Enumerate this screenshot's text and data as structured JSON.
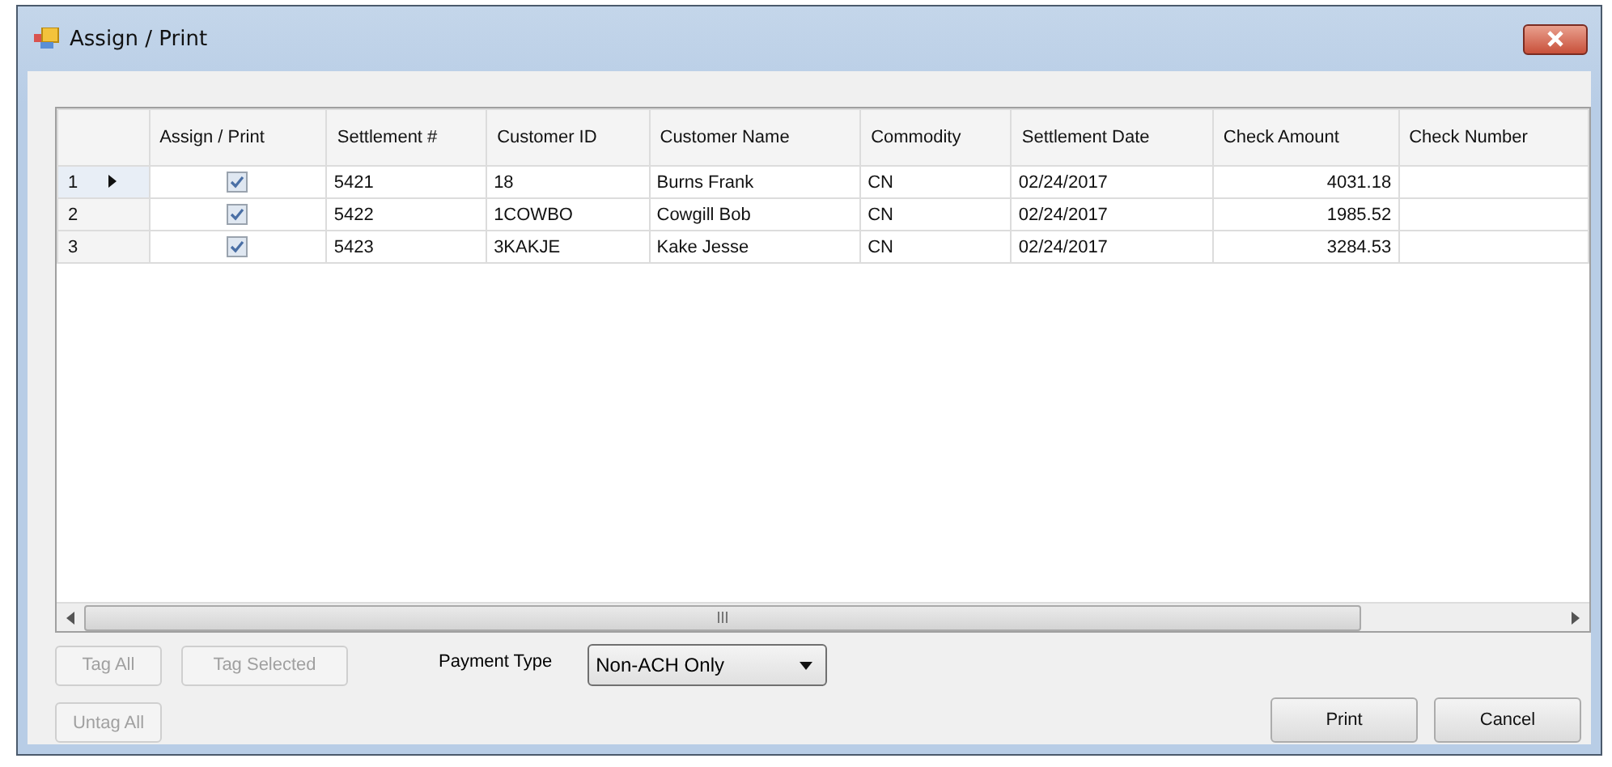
{
  "window": {
    "title": "Assign / Print"
  },
  "table": {
    "columns": [
      "",
      "Assign / Print",
      "Settlement #",
      "Customer ID",
      "Customer Name",
      "Commodity",
      "Settlement Date",
      "Check Amount",
      "Check Number"
    ],
    "rows": [
      {
        "selected": true,
        "checked": true,
        "cells": [
          "1",
          "",
          "5421",
          "18",
          "Burns Frank",
          "CN",
          "02/24/2017",
          "4031.18",
          ""
        ]
      },
      {
        "selected": false,
        "checked": true,
        "cells": [
          "2",
          "",
          "5422",
          "1COWBO",
          "Cowgill Bob",
          "CN",
          "02/24/2017",
          "1985.52",
          ""
        ]
      },
      {
        "selected": false,
        "checked": true,
        "cells": [
          "3",
          "",
          "5423",
          "3KAKJE",
          "Kake Jesse",
          "CN",
          "02/24/2017",
          "3284.53",
          ""
        ]
      }
    ]
  },
  "tag_buttons": [
    {
      "label": "Tag All",
      "disabled": true
    },
    {
      "label": "Tag Selected",
      "disabled": true
    },
    {
      "label": "Untag All",
      "disabled": true
    }
  ],
  "payment_type": {
    "label": "Payment Type",
    "value": "Non-ACH Only"
  },
  "buttons": [
    {
      "label": "Print",
      "disabled": false
    },
    {
      "label": "Cancel",
      "disabled": false
    }
  ]
}
